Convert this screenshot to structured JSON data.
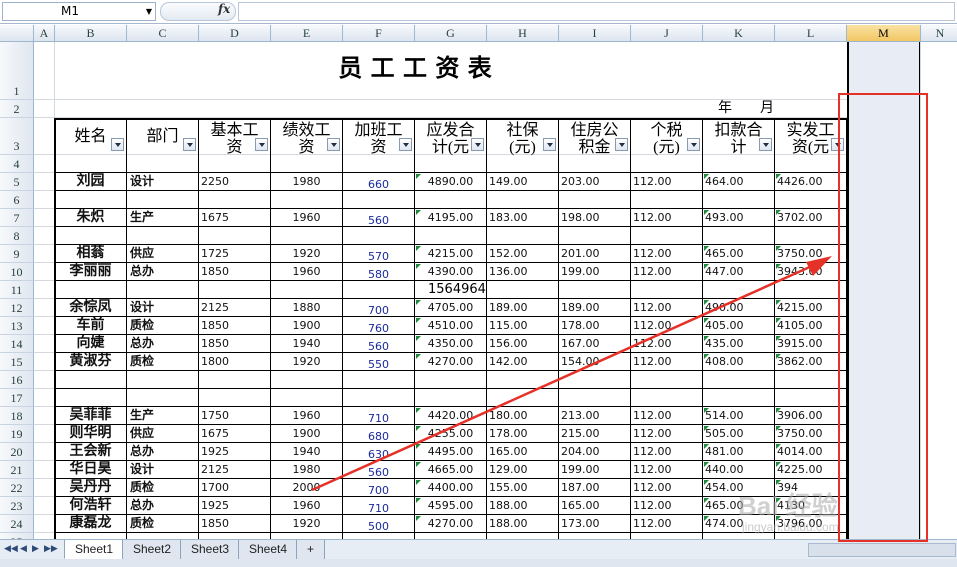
{
  "formula_bar": {
    "name_box": "M1",
    "fx": "fx",
    "formula": ""
  },
  "columns": [
    "A",
    "B",
    "C",
    "D",
    "E",
    "F",
    "G",
    "H",
    "I",
    "J",
    "K",
    "L",
    "M",
    "N"
  ],
  "selected_column": "M",
  "rows": [
    "1",
    "2",
    "3",
    "4",
    "5",
    "6",
    "7",
    "8",
    "9",
    "10",
    "11",
    "12",
    "13",
    "14",
    "15",
    "16",
    "17",
    "18",
    "19",
    "20",
    "21",
    "22",
    "23",
    "24",
    "25"
  ],
  "title": "员 工 工 资 表",
  "year_label": "年",
  "month_label": "月",
  "headers": [
    {
      "line1": "姓名",
      "line2": ""
    },
    {
      "line1": "部门",
      "line2": ""
    },
    {
      "line1": "基本工",
      "line2": "资"
    },
    {
      "line1": "绩效工",
      "line2": "资"
    },
    {
      "line1": "加班工",
      "line2": "资"
    },
    {
      "line1": "应发合",
      "line2": "计(元"
    },
    {
      "line1": "社保",
      "line2": "(元)"
    },
    {
      "line1": "住房公",
      "line2": "积金"
    },
    {
      "line1": "个税",
      "line2": "(元)"
    },
    {
      "line1": "扣款合",
      "line2": "计"
    },
    {
      "line1": "实发工",
      "line2": "资(元"
    }
  ],
  "records": [
    {
      "row": 5,
      "name": "刘园",
      "dept": "设计",
      "basic": "2250",
      "perf": "1980",
      "overtime": "660",
      "gross": "4890.00",
      "social": "149.00",
      "housing": "203.00",
      "tax": "112.00",
      "deduct": "464.00",
      "net": "4426.00"
    },
    {
      "row": 7,
      "name": "朱炽",
      "dept": "生产",
      "basic": "1675",
      "perf": "1960",
      "overtime": "560",
      "gross": "4195.00",
      "social": "183.00",
      "housing": "198.00",
      "tax": "112.00",
      "deduct": "493.00",
      "net": "3702.00"
    },
    {
      "row": 9,
      "name": "相蓊",
      "dept": "供应",
      "basic": "1725",
      "perf": "1920",
      "overtime": "570",
      "gross": "4215.00",
      "social": "152.00",
      "housing": "201.00",
      "tax": "112.00",
      "deduct": "465.00",
      "net": "3750.00"
    },
    {
      "row": 10,
      "name": "李丽丽",
      "dept": "总办",
      "basic": "1850",
      "perf": "1960",
      "overtime": "580",
      "gross": "4390.00",
      "social": "136.00",
      "housing": "199.00",
      "tax": "112.00",
      "deduct": "447.00",
      "net": "3943.00"
    },
    {
      "row": 12,
      "name": "余悰凤",
      "dept": "设计",
      "basic": "2125",
      "perf": "1880",
      "overtime": "700",
      "gross": "4705.00",
      "social": "189.00",
      "housing": "189.00",
      "tax": "112.00",
      "deduct": "490.00",
      "net": "4215.00"
    },
    {
      "row": 13,
      "name": "车前",
      "dept": "质检",
      "basic": "1850",
      "perf": "1900",
      "overtime": "760",
      "gross": "4510.00",
      "social": "115.00",
      "housing": "178.00",
      "tax": "112.00",
      "deduct": "405.00",
      "net": "4105.00"
    },
    {
      "row": 14,
      "name": "向婕",
      "dept": "总办",
      "basic": "1850",
      "perf": "1940",
      "overtime": "560",
      "gross": "4350.00",
      "social": "156.00",
      "housing": "167.00",
      "tax": "112.00",
      "deduct": "435.00",
      "net": "3915.00"
    },
    {
      "row": 15,
      "name": "黄淑芬",
      "dept": "质检",
      "basic": "1800",
      "perf": "1920",
      "overtime": "550",
      "gross": "4270.00",
      "social": "142.00",
      "housing": "154.00",
      "tax": "112.00",
      "deduct": "408.00",
      "net": "3862.00"
    },
    {
      "row": 18,
      "name": "吴菲菲",
      "dept": "生产",
      "basic": "1750",
      "perf": "1960",
      "overtime": "710",
      "gross": "4420.00",
      "social": "180.00",
      "housing": "213.00",
      "tax": "112.00",
      "deduct": "514.00",
      "net": "3906.00"
    },
    {
      "row": 19,
      "name": "则华明",
      "dept": "供应",
      "basic": "1675",
      "perf": "1900",
      "overtime": "680",
      "gross": "4255.00",
      "social": "178.00",
      "housing": "215.00",
      "tax": "112.00",
      "deduct": "505.00",
      "net": "3750.00"
    },
    {
      "row": 20,
      "name": "王会新",
      "dept": "总办",
      "basic": "1925",
      "perf": "1940",
      "overtime": "630",
      "gross": "4495.00",
      "social": "165.00",
      "housing": "204.00",
      "tax": "112.00",
      "deduct": "481.00",
      "net": "4014.00"
    },
    {
      "row": 21,
      "name": "华日昊",
      "dept": "设计",
      "basic": "2125",
      "perf": "1980",
      "overtime": "560",
      "gross": "4665.00",
      "social": "129.00",
      "housing": "199.00",
      "tax": "112.00",
      "deduct": "440.00",
      "net": "4225.00"
    },
    {
      "row": 22,
      "name": "吴丹丹",
      "dept": "质检",
      "basic": "1700",
      "perf": "2000",
      "overtime": "700",
      "gross": "4400.00",
      "social": "155.00",
      "housing": "187.00",
      "tax": "112.00",
      "deduct": "454.00",
      "net": "394"
    },
    {
      "row": 23,
      "name": "何浩轩",
      "dept": "总办",
      "basic": "1925",
      "perf": "1960",
      "overtime": "710",
      "gross": "4595.00",
      "social": "188.00",
      "housing": "165.00",
      "tax": "112.00",
      "deduct": "465.00",
      "net": "4130"
    },
    {
      "row": 24,
      "name": "康磊龙",
      "dept": "质检",
      "basic": "1850",
      "perf": "1920",
      "overtime": "500",
      "gross": "4270.00",
      "social": "188.00",
      "housing": "173.00",
      "tax": "112.00",
      "deduct": "474.00",
      "net": "3796.00"
    }
  ],
  "extra_value": {
    "row": 11,
    "col": "G",
    "text": "1564964"
  },
  "sheets": [
    "Sheet1",
    "Sheet2",
    "Sheet3",
    "Sheet4"
  ],
  "active_sheet": "Sheet1",
  "watermark": "Bai 经验",
  "watermark_url": "jingyan.baidu.com",
  "colors": {
    "selection_box": "#e53127",
    "arrow": "#e53127",
    "selected_column_bg": "#e8ecf4",
    "header_bg": "#dde5ef"
  }
}
